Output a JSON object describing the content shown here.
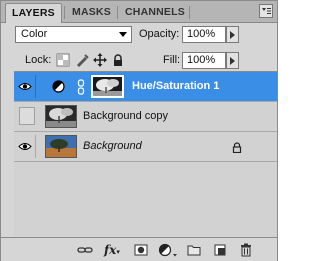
{
  "tabs": [
    {
      "label": "LAYERS",
      "active": true
    },
    {
      "label": "MASKS",
      "active": false
    },
    {
      "label": "CHANNELS",
      "active": false
    }
  ],
  "blend_mode": "Color",
  "opacity": {
    "label": "Opacity:",
    "value": "100%"
  },
  "lock": {
    "label": "Lock:",
    "icons": [
      "lock-transparent-pixels-icon",
      "lock-image-pixels-icon",
      "lock-position-icon",
      "lock-all-icon"
    ]
  },
  "fill": {
    "label": "Fill:",
    "value": "100%"
  },
  "layers": [
    {
      "name": "Hue/Saturation 1",
      "visible": true,
      "selected": true,
      "type": "adjustment"
    },
    {
      "name": "Background copy",
      "visible": false,
      "selected": false,
      "type": "pixel"
    },
    {
      "name": "Background",
      "visible": true,
      "selected": false,
      "type": "pixel",
      "locked": true
    }
  ],
  "bottom_icons": [
    "link-layers-icon",
    "layer-style-icon",
    "add-mask-icon",
    "new-adjustment-layer-icon",
    "new-group-icon",
    "new-layer-icon",
    "delete-layer-icon"
  ],
  "colors": {
    "selected_row": "#3b8ee6",
    "panel_bg": "#d6d6d6"
  }
}
